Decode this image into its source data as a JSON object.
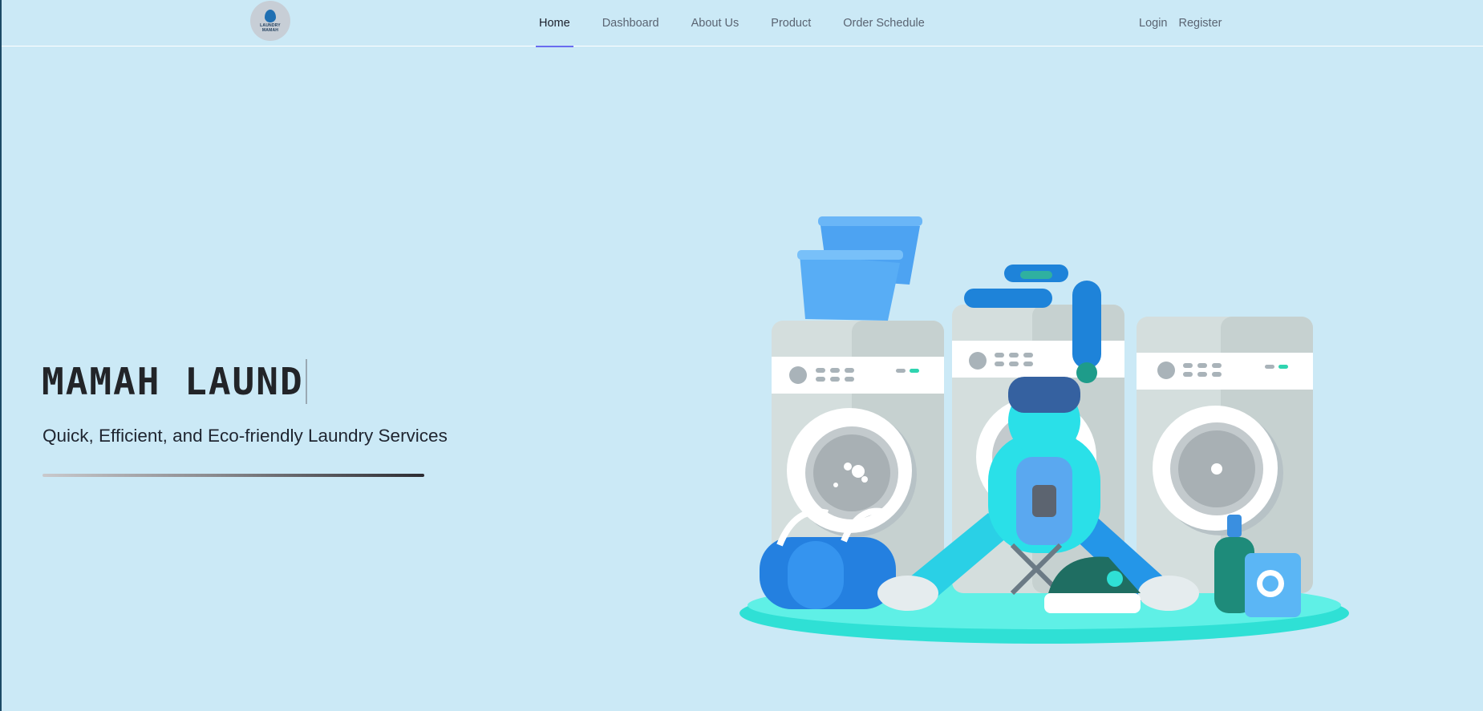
{
  "brand": {
    "logo_text_1": "LAUNDRY",
    "logo_text_2": "MAMAH"
  },
  "nav": {
    "items": [
      {
        "label": "Home",
        "active": true
      },
      {
        "label": "Dashboard",
        "active": false
      },
      {
        "label": "About Us",
        "active": false
      },
      {
        "label": "Product",
        "active": false
      },
      {
        "label": "Order Schedule",
        "active": false
      }
    ],
    "auth": [
      {
        "label": "Login"
      },
      {
        "label": "Register"
      }
    ]
  },
  "hero": {
    "title": "MAMAH LAUND",
    "subtitle": "Quick, Efficient, and Eco-friendly Laundry Services",
    "illustration": "laundromat-illustration"
  },
  "colors": {
    "background": "#cbe9f6",
    "nav_active_underline": "#6a6cf0",
    "accent_teal": "#2fe0d5",
    "accent_blue": "#3d8ff0"
  }
}
